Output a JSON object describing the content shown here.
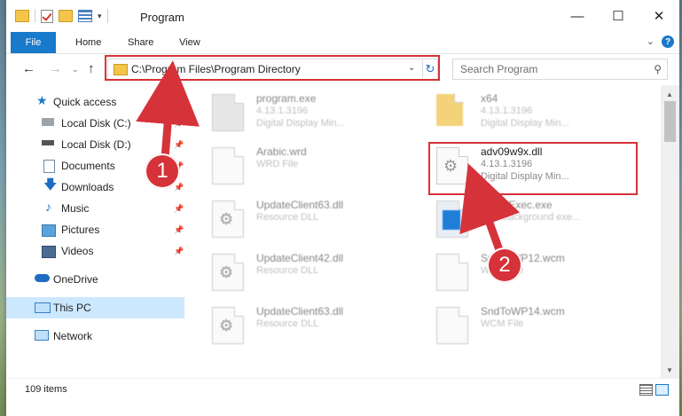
{
  "window": {
    "title": "Program",
    "minimize": "—",
    "maximize": "☐",
    "close": "✕"
  },
  "ribbon": {
    "tabs": [
      "File",
      "Home",
      "Share",
      "View"
    ],
    "help": "?"
  },
  "nav": {
    "address": "C:\\Program Files\\Program Directory",
    "search_placeholder": "Search Program"
  },
  "sidebar": {
    "items": [
      {
        "label": "Quick access",
        "icon": "star-icon",
        "pinned": false
      },
      {
        "label": "Local Disk (C:)",
        "icon": "drive-icon",
        "pinned": true
      },
      {
        "label": "Local Disk (D:)",
        "icon": "drive-icon",
        "pinned": true
      },
      {
        "label": "Documents",
        "icon": "documents-icon",
        "pinned": true
      },
      {
        "label": "Downloads",
        "icon": "download-icon",
        "pinned": true
      },
      {
        "label": "Music",
        "icon": "music-icon",
        "pinned": true
      },
      {
        "label": "Pictures",
        "icon": "pictures-icon",
        "pinned": true
      },
      {
        "label": "Videos",
        "icon": "videos-icon",
        "pinned": true
      },
      {
        "label": "OneDrive",
        "icon": "cloud-icon",
        "pinned": false
      },
      {
        "label": "This PC",
        "icon": "computer-icon",
        "pinned": false,
        "selected": true
      },
      {
        "label": "Network",
        "icon": "network-icon",
        "pinned": false
      }
    ]
  },
  "files": [
    {
      "name": "program.exe",
      "line1": "4.13.1.3196",
      "line2": "Digital Display Min...",
      "icon": "exe-icon"
    },
    {
      "name": "x64",
      "line1": "4.13.1.3196",
      "line2": "Digital Display Min...",
      "icon": "folder-icon"
    },
    {
      "name": "Arabic.wrd",
      "line1": "WRD File",
      "line2": "",
      "icon": "file-icon"
    },
    {
      "name": "adv09w9x.dll",
      "line1": "4.13.1.3196",
      "line2": "Digital Display Min...",
      "icon": "dll-gear-icon",
      "highlighted": true
    },
    {
      "name": "UpdateClient63.dll",
      "line1": "Resource DLL",
      "line2": "",
      "icon": "dll-gear-icon"
    },
    {
      "name": "SetupExec.exe",
      "line1": "ABY background exe...",
      "line2": "",
      "icon": "setup-icon"
    },
    {
      "name": "UpdateClient42.dll",
      "line1": "Resource DLL",
      "line2": "",
      "icon": "dll-gear-icon"
    },
    {
      "name": "SndToWP12.wcm",
      "line1": "WCM File",
      "line2": "",
      "icon": "file-icon"
    },
    {
      "name": "UpdateClient63.dll",
      "line1": "Resource DLL",
      "line2": "",
      "icon": "dll-gear-icon"
    },
    {
      "name": "SndToWP14.wcm",
      "line1": "WCM File",
      "line2": "",
      "icon": "file-icon"
    }
  ],
  "status": {
    "items_count": "109 items"
  },
  "callouts": [
    "1",
    "2"
  ],
  "colors": {
    "accent": "#1979ca",
    "highlight": "#d6323a",
    "selected": "#cce8ff"
  }
}
